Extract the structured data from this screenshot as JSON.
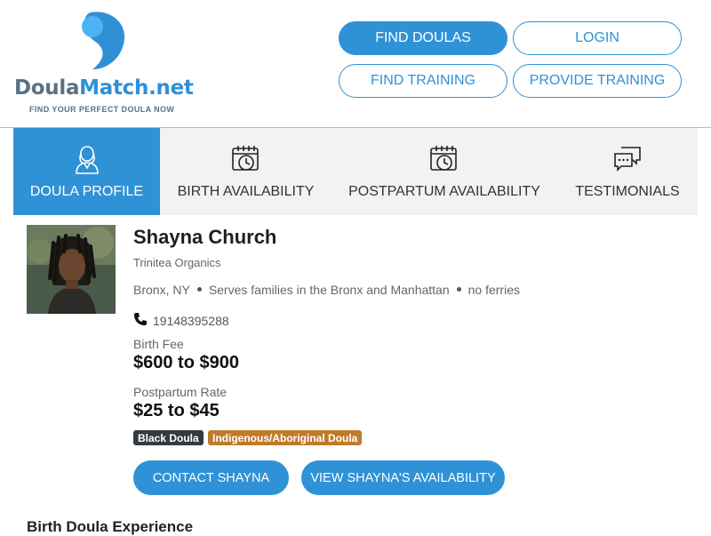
{
  "brand": {
    "name_part1": "Doula",
    "name_part2": "Match.net",
    "tagline": "FIND YOUR PERFECT DOULA NOW",
    "logo_colors": {
      "primary": "#2f90d8",
      "secondary": "#4db3f3",
      "dark": "#5a7185"
    }
  },
  "header_nav": {
    "find_doulas": "FIND DOULAS",
    "login": "LOGIN",
    "find_training": "FIND TRAINING",
    "provide_training": "PROVIDE TRAINING"
  },
  "tabs": [
    {
      "label": "DOULA PROFILE",
      "icon": "doula-person-icon",
      "active": true
    },
    {
      "label": "BIRTH AVAILABILITY",
      "icon": "calendar-clock-icon",
      "active": false
    },
    {
      "label": "POSTPARTUM AVAILABILITY",
      "icon": "calendar-clock-icon",
      "active": false
    },
    {
      "label": "TESTIMONIALS",
      "icon": "chat-bubbles-icon",
      "active": false
    }
  ],
  "profile": {
    "name": "Shayna Church",
    "organization": "Trinitea Organics",
    "location": "Bronx, NY",
    "service_area": "Serves families in the Bronx and Manhattan",
    "note": "no ferries",
    "phone": "19148395288",
    "birth_fee_label": "Birth Fee",
    "birth_fee": "$600 to $900",
    "postpartum_label": "Postpartum Rate",
    "postpartum_rate": "$25 to $45",
    "badges": [
      "Black Doula",
      "Indigenous/Aboriginal Doula"
    ],
    "contact_button": "CONTACT SHAYNA",
    "availability_button": "VIEW SHAYNA'S AVAILABILITY"
  },
  "sections": {
    "birth_experience_title": "Birth Doula Experience"
  },
  "colors": {
    "accent": "#2f92d6",
    "badge_dark": "#343a40",
    "badge_orange": "#c07a2b",
    "tab_bg": "#f2f2f2"
  }
}
